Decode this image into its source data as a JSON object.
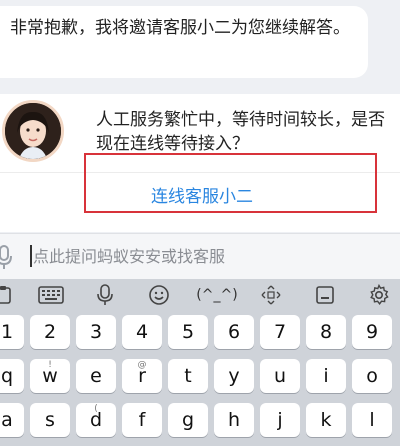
{
  "messages": {
    "top_bubble": "非常抱歉，我将邀请客服小二为您继续解答。",
    "card_line1": "人工服务繁忙中，等待时间较长，是否",
    "card_line2": "现在连线等待接入？",
    "connect_button": "连线客服小二"
  },
  "input": {
    "placeholder": "点此提问蚂蚁安安或找客服"
  },
  "keyboard": {
    "toolbar": {
      "kaomoji": "(^_^)"
    },
    "number_row": [
      "1",
      "2",
      "3",
      "4",
      "5",
      "6",
      "7",
      "8",
      "9"
    ],
    "top_row": [
      "q",
      "w",
      "e",
      "r",
      "t",
      "y",
      "u",
      "i",
      "o"
    ],
    "top_row_hints": [
      "",
      "!",
      "",
      "@",
      "",
      "",
      "",
      "",
      ""
    ],
    "home_row": [
      "a",
      "s",
      "d",
      "f",
      "g",
      "h",
      "j",
      "k",
      "l"
    ],
    "home_row_hints": [
      "",
      "",
      "(",
      "",
      "",
      "",
      "",
      "",
      ""
    ]
  },
  "colors": {
    "accent_link": "#2a86e0",
    "highlight_frame": "#d8333a",
    "keyboard_bg": "#cfd3d9"
  }
}
